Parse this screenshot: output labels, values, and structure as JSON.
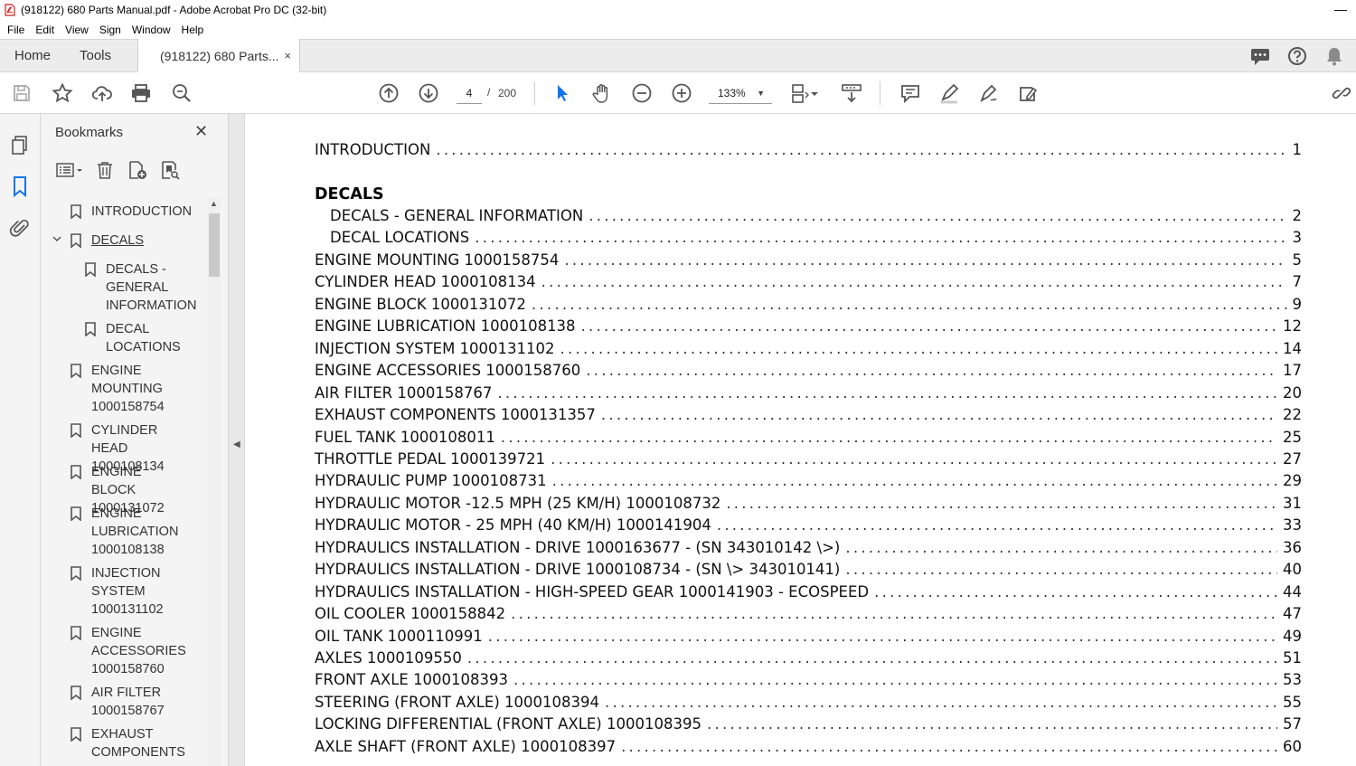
{
  "window": {
    "title": "(918122) 680 Parts Manual.pdf - Adobe Acrobat Pro DC (32-bit)",
    "app_icon": "acrobat-pdf-icon"
  },
  "menu": [
    "File",
    "Edit",
    "View",
    "Sign",
    "Window",
    "Help"
  ],
  "tabs": {
    "home": "Home",
    "tools": "Tools",
    "document": "(918122) 680 Parts...",
    "close": "×"
  },
  "toolbar": {
    "current_page": "4",
    "page_separator": "/",
    "total_pages": "200",
    "zoom": "133%"
  },
  "bookmarks_panel": {
    "title": "Bookmarks",
    "close": "✕",
    "items": [
      {
        "label": "INTRODUCTION"
      },
      {
        "label": "DECALS"
      },
      {
        "label": "DECALS -\nGENERAL\nINFORMATION"
      },
      {
        "label": "DECAL\nLOCATIONS"
      },
      {
        "label": "ENGINE\nMOUNTING\n1000158754"
      },
      {
        "label": "CYLINDER HEAD\n1000108134"
      },
      {
        "label": "ENGINE BLOCK\n1000131072"
      },
      {
        "label": "ENGINE\nLUBRICATION\n1000108138"
      },
      {
        "label": "INJECTION\nSYSTEM\n1000131102"
      },
      {
        "label": "ENGINE\nACCESSORIES\n1000158760"
      },
      {
        "label": "AIR FILTER\n1000158767"
      },
      {
        "label": "EXHAUST\nCOMPONENTS"
      }
    ]
  },
  "document": {
    "introduction": {
      "entry": "INTRODUCTION",
      "page": "1"
    },
    "section_heading": "DECALS",
    "toc": [
      {
        "entry": "DECALS - GENERAL INFORMATION",
        "page": "2"
      },
      {
        "entry": "DECAL LOCATIONS",
        "page": "3"
      },
      {
        "entry": "ENGINE MOUNTING 1000158754",
        "page": "5"
      },
      {
        "entry": "CYLINDER HEAD 1000108134",
        "page": "7"
      },
      {
        "entry": "ENGINE BLOCK 1000131072",
        "page": "9"
      },
      {
        "entry": "ENGINE LUBRICATION 1000108138",
        "page": "12"
      },
      {
        "entry": "INJECTION SYSTEM 1000131102",
        "page": "14"
      },
      {
        "entry": "ENGINE ACCESSORIES 1000158760",
        "page": "17"
      },
      {
        "entry": "AIR FILTER 1000158767",
        "page": "20"
      },
      {
        "entry": "EXHAUST COMPONENTS 1000131357",
        "page": "22"
      },
      {
        "entry": "FUEL TANK 1000108011",
        "page": "25"
      },
      {
        "entry": "THROTTLE PEDAL 1000139721",
        "page": "27"
      },
      {
        "entry": "HYDRAULIC PUMP 1000108731",
        "page": "29"
      },
      {
        "entry": "HYDRAULIC MOTOR -12.5 MPH (25 KM/H) 1000108732",
        "page": "31"
      },
      {
        "entry": "HYDRAULIC MOTOR - 25 MPH (40 KM/H) 1000141904",
        "page": "33"
      },
      {
        "entry": "HYDRAULICS INSTALLATION - DRIVE 1000163677 - (SN 343010142 \\>)",
        "page": "36"
      },
      {
        "entry": "HYDRAULICS INSTALLATION - DRIVE 1000108734 - (SN \\> 343010141)",
        "page": "40"
      },
      {
        "entry": "HYDRAULICS INSTALLATION - HIGH-SPEED GEAR 1000141903 - ECOSPEED",
        "page": "44"
      },
      {
        "entry": "OIL COOLER 1000158842",
        "page": "47"
      },
      {
        "entry": "OIL TANK 1000110991",
        "page": "49"
      },
      {
        "entry": "AXLES 1000109550",
        "page": "51"
      },
      {
        "entry": "FRONT AXLE 1000108393",
        "page": "53"
      },
      {
        "entry": "STEERING (FRONT AXLE) 1000108394",
        "page": "55"
      },
      {
        "entry": "LOCKING DIFFERENTIAL (FRONT AXLE) 1000108395",
        "page": "57"
      },
      {
        "entry": "AXLE SHAFT (FRONT AXLE) 1000108397",
        "page": "60"
      }
    ]
  }
}
